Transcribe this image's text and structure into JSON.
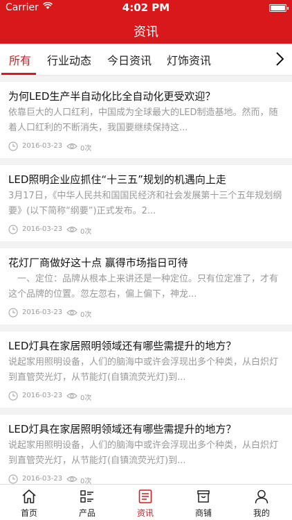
{
  "status_bar": {
    "carrier": "Carrier",
    "time": "4:02 PM"
  },
  "header": {
    "title": "资讯"
  },
  "tabs": [
    {
      "label": "所有",
      "active": true
    },
    {
      "label": "行业动态",
      "active": false
    },
    {
      "label": "今日资讯",
      "active": false
    },
    {
      "label": "灯饰资讯",
      "active": false
    }
  ],
  "articles": [
    {
      "title": "为何LED生产半自动化比全自动化更受欢迎？",
      "summary": "依靠巨大的人口红利，中国成为全球最大的LED制造基地。然而，随着人口红利的不断消失，我国要继续保持这...",
      "date": "2016-03-23",
      "views": "0次"
    },
    {
      "title": "LED照明企业应抓住“十三五”规划的机遇向上走",
      "summary": "3月17日，《中华人民共和国国民经济和社会发展第十三个五年规划纲要》(以下简称“纲要”)正式发布。2...",
      "date": "2016-03-23",
      "views": "0次"
    },
    {
      "title": "花灯厂商做好这十点 赢得市场指日可待",
      "summary": "　一、定位：品牌从根本上来讲还是一种定位。只有位定准了，才有这个品牌的位置。忽左忽右，偏上偏下，神龙...",
      "date": "2016-03-23",
      "views": "0次"
    },
    {
      "title": "LED灯具在家居照明领域还有哪些需提升的地方？",
      "summary": "说起家用照明设备，人们的脑海中或许会浮现出多个种类，从白炽灯到直管荧光灯，从节能灯(自镇流荧光灯)到...",
      "date": "2016-03-23",
      "views": "0次"
    },
    {
      "title": "LED灯具在家居照明领域还有哪些需提升的地方？",
      "summary": "说起家用照明设备，人们的脑海中或许会浮现出多个种类，从白炽灯到直管荧光灯，从节能灯(自镇流荧光灯)到...",
      "date": "2016-03-23",
      "views": "0次"
    }
  ],
  "bottom_nav": [
    {
      "label": "首页",
      "icon": "home-icon",
      "active": false
    },
    {
      "label": "产品",
      "icon": "product-list-icon",
      "active": false
    },
    {
      "label": "资讯",
      "icon": "news-icon",
      "active": true
    },
    {
      "label": "商铺",
      "icon": "store-icon",
      "active": false
    },
    {
      "label": "我的",
      "icon": "user-icon",
      "active": false
    }
  ],
  "colors": {
    "brand": "#d8181a",
    "text": "#111111",
    "muted": "#999999"
  }
}
